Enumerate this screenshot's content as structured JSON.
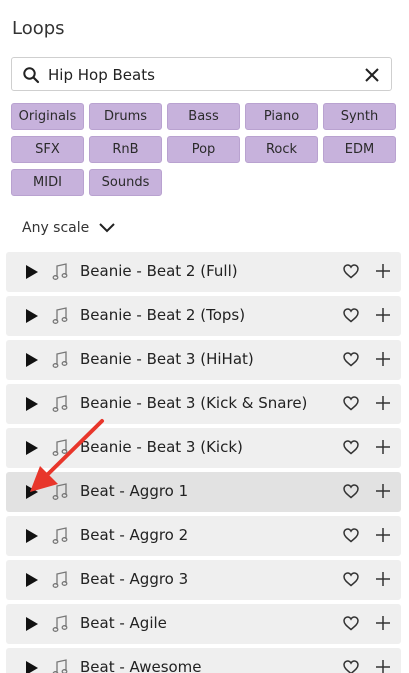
{
  "title": "Loops",
  "search": {
    "value": "Hip Hop Beats"
  },
  "chips": [
    "Originals",
    "Drums",
    "Bass",
    "Piano",
    "Synth",
    "SFX",
    "RnB",
    "Pop",
    "Rock",
    "EDM",
    "MIDI",
    "Sounds"
  ],
  "scale_label": "Any scale",
  "loops": [
    "Beanie - Beat 2 (Full)",
    "Beanie - Beat 2 (Tops)",
    "Beanie - Beat 3 (HiHat)",
    "Beanie - Beat 3 (Kick & Snare)",
    "Beanie - Beat 3 (Kick)",
    "Beat - Aggro 1",
    "Beat - Aggro 2",
    "Beat - Aggro 3",
    "Beat - Agile",
    "Beat - Awesome"
  ],
  "colors": {
    "chip": "#c7b2dc",
    "row": "#efefef",
    "annotation_arrow": "#e8362b"
  },
  "icons": [
    "search-icon",
    "close-icon",
    "chevron-down-icon",
    "play-icon",
    "music-note-icon",
    "heart-icon",
    "plus-icon"
  ]
}
